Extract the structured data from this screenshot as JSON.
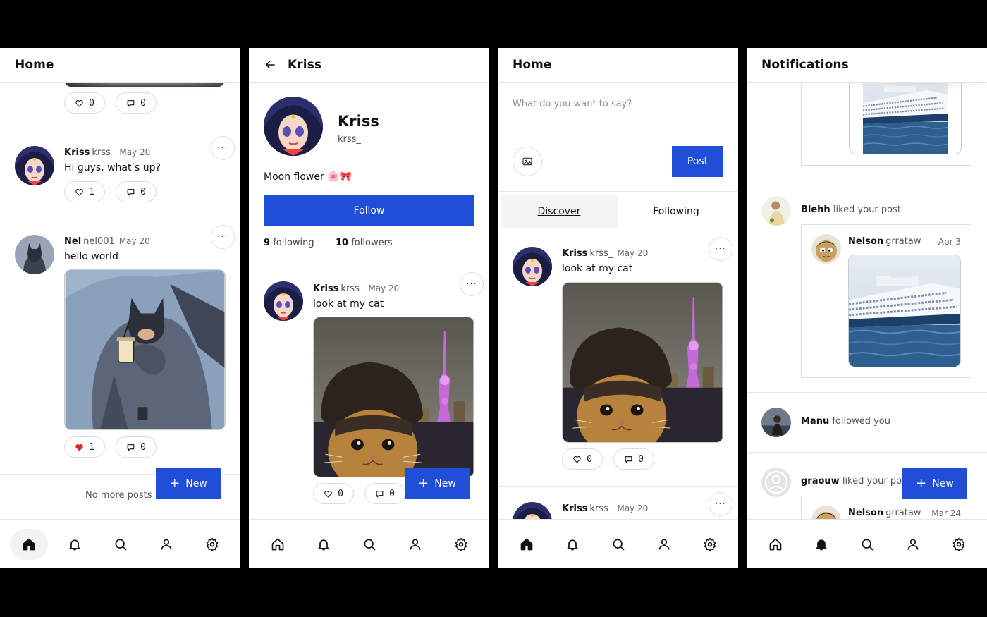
{
  "screens": {
    "home1": {
      "title": "Home",
      "top_post": {
        "likes": "0",
        "comments": "0"
      },
      "post1": {
        "name": "Kriss",
        "handle": "krss_",
        "date": "May 20",
        "text": "Hi guys, what’s up?",
        "likes": "1",
        "comments": "0"
      },
      "post2": {
        "name": "Nel",
        "handle": "nel001",
        "date": "May 20",
        "text": "hello world",
        "likes": "1",
        "comments": "0"
      },
      "no_more": "No more posts",
      "new_label": "New"
    },
    "profile": {
      "title": "Kriss",
      "display_name": "Kriss",
      "handle": "krss_",
      "bio": "Moon flower 🌸🎀",
      "follow_label": "Follow",
      "following_count": "9",
      "following_label": "following",
      "followers_count": "10",
      "followers_label": "followers",
      "post": {
        "name": "Kriss",
        "handle": "krss_",
        "date": "May 20",
        "text": "look at my cat",
        "likes": "0",
        "comments": "0"
      },
      "new_label": "New"
    },
    "home2": {
      "title": "Home",
      "compose_placeholder": "What do you want to say?",
      "post_label": "Post",
      "tab_discover": "Discover",
      "tab_following": "Following",
      "post1": {
        "name": "Kriss",
        "handle": "krss_",
        "date": "May 20",
        "text": "look at my cat",
        "likes": "0",
        "comments": "0"
      },
      "post2": {
        "name": "Kriss",
        "handle": "krss_",
        "date": "May 20"
      }
    },
    "notifications": {
      "title": "Notifications",
      "n1": {
        "name": "Blehh",
        "action": "liked your post"
      },
      "n1_post": {
        "name": "Nelson",
        "handle": "grrataw",
        "date": "Apr 3"
      },
      "n2": {
        "name": "Manu",
        "action": "followed you"
      },
      "n3": {
        "name": "graouw",
        "action": "liked your post"
      },
      "n3_post": {
        "name": "Nelson",
        "handle": "grrataw",
        "date": "Mar 24"
      },
      "new_label": "New"
    }
  },
  "colors": {
    "accent": "#1f4fd8",
    "heart_red": "#e0262a",
    "border": "#e6e6e6"
  },
  "icons": [
    "home-icon",
    "bell-icon",
    "search-icon",
    "user-icon",
    "gear-icon",
    "heart-icon",
    "comment-icon",
    "more-icon",
    "image-icon",
    "back-arrow-icon",
    "plus-icon"
  ]
}
